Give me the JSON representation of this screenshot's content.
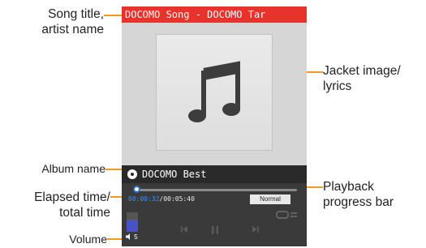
{
  "annotations": {
    "song_title_artist": [
      "Song title,",
      "artist name"
    ],
    "jacket_image": [
      "Jacket image/",
      "lyrics"
    ],
    "album_name": "Album name",
    "elapsed_total": [
      "Elapsed time/",
      "total time"
    ],
    "playback_progress": [
      "Playback",
      "progress bar"
    ],
    "volume": "Volume"
  },
  "player": {
    "title_bar": "DOCOMO Song - DOCOMO Tar",
    "album": "DOCOMO Best",
    "elapsed": "00:00:32",
    "total": "/00:05:40",
    "mode": "Normal",
    "progress_fraction": 0.02,
    "volume_level": 5,
    "volume_label": "5",
    "icons": {
      "jacket": "music-note-icon",
      "album": "disc-icon",
      "volume": "speaker-icon",
      "prev": "previous-track-icon",
      "pause": "pause-icon",
      "next": "next-track-icon",
      "repeat": "repeat-icon"
    }
  },
  "colors": {
    "title_bar": "#e8332c",
    "leader_lines": "#f39a1e",
    "elapsed_time": "#3a8ff0",
    "knob_border": "#2a6fcf"
  }
}
